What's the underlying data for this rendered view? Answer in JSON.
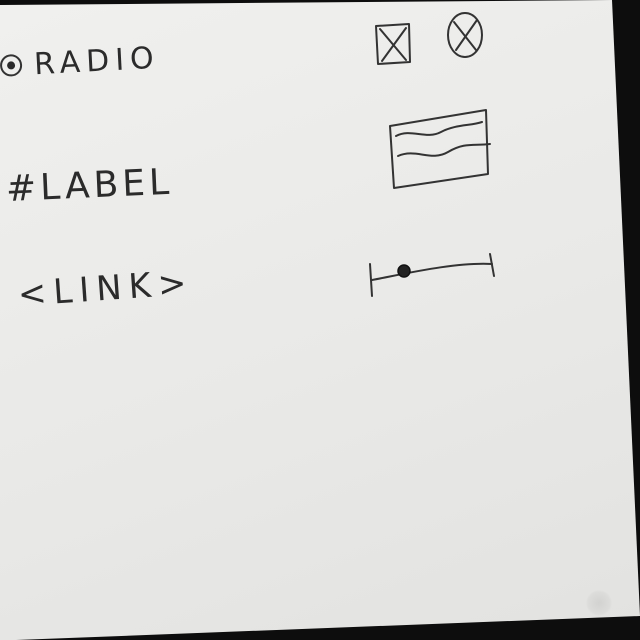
{
  "radio": {
    "label": "RADIO",
    "selected": true
  },
  "label": {
    "text": "#LABEL"
  },
  "link": {
    "text": "<LINK>"
  },
  "checkbox": {
    "checked": true,
    "icon": "checkbox-x-icon"
  },
  "round_toggle": {
    "checked": true,
    "icon": "circle-x-icon"
  },
  "text_area": {
    "icon": "text-area-wavy-lines"
  },
  "slider": {
    "value": 0.27,
    "icon": "slider-knob"
  },
  "colors": {
    "paper": "#ececea",
    "ink": "#2b2b2b",
    "background": "#0d0d0d"
  }
}
